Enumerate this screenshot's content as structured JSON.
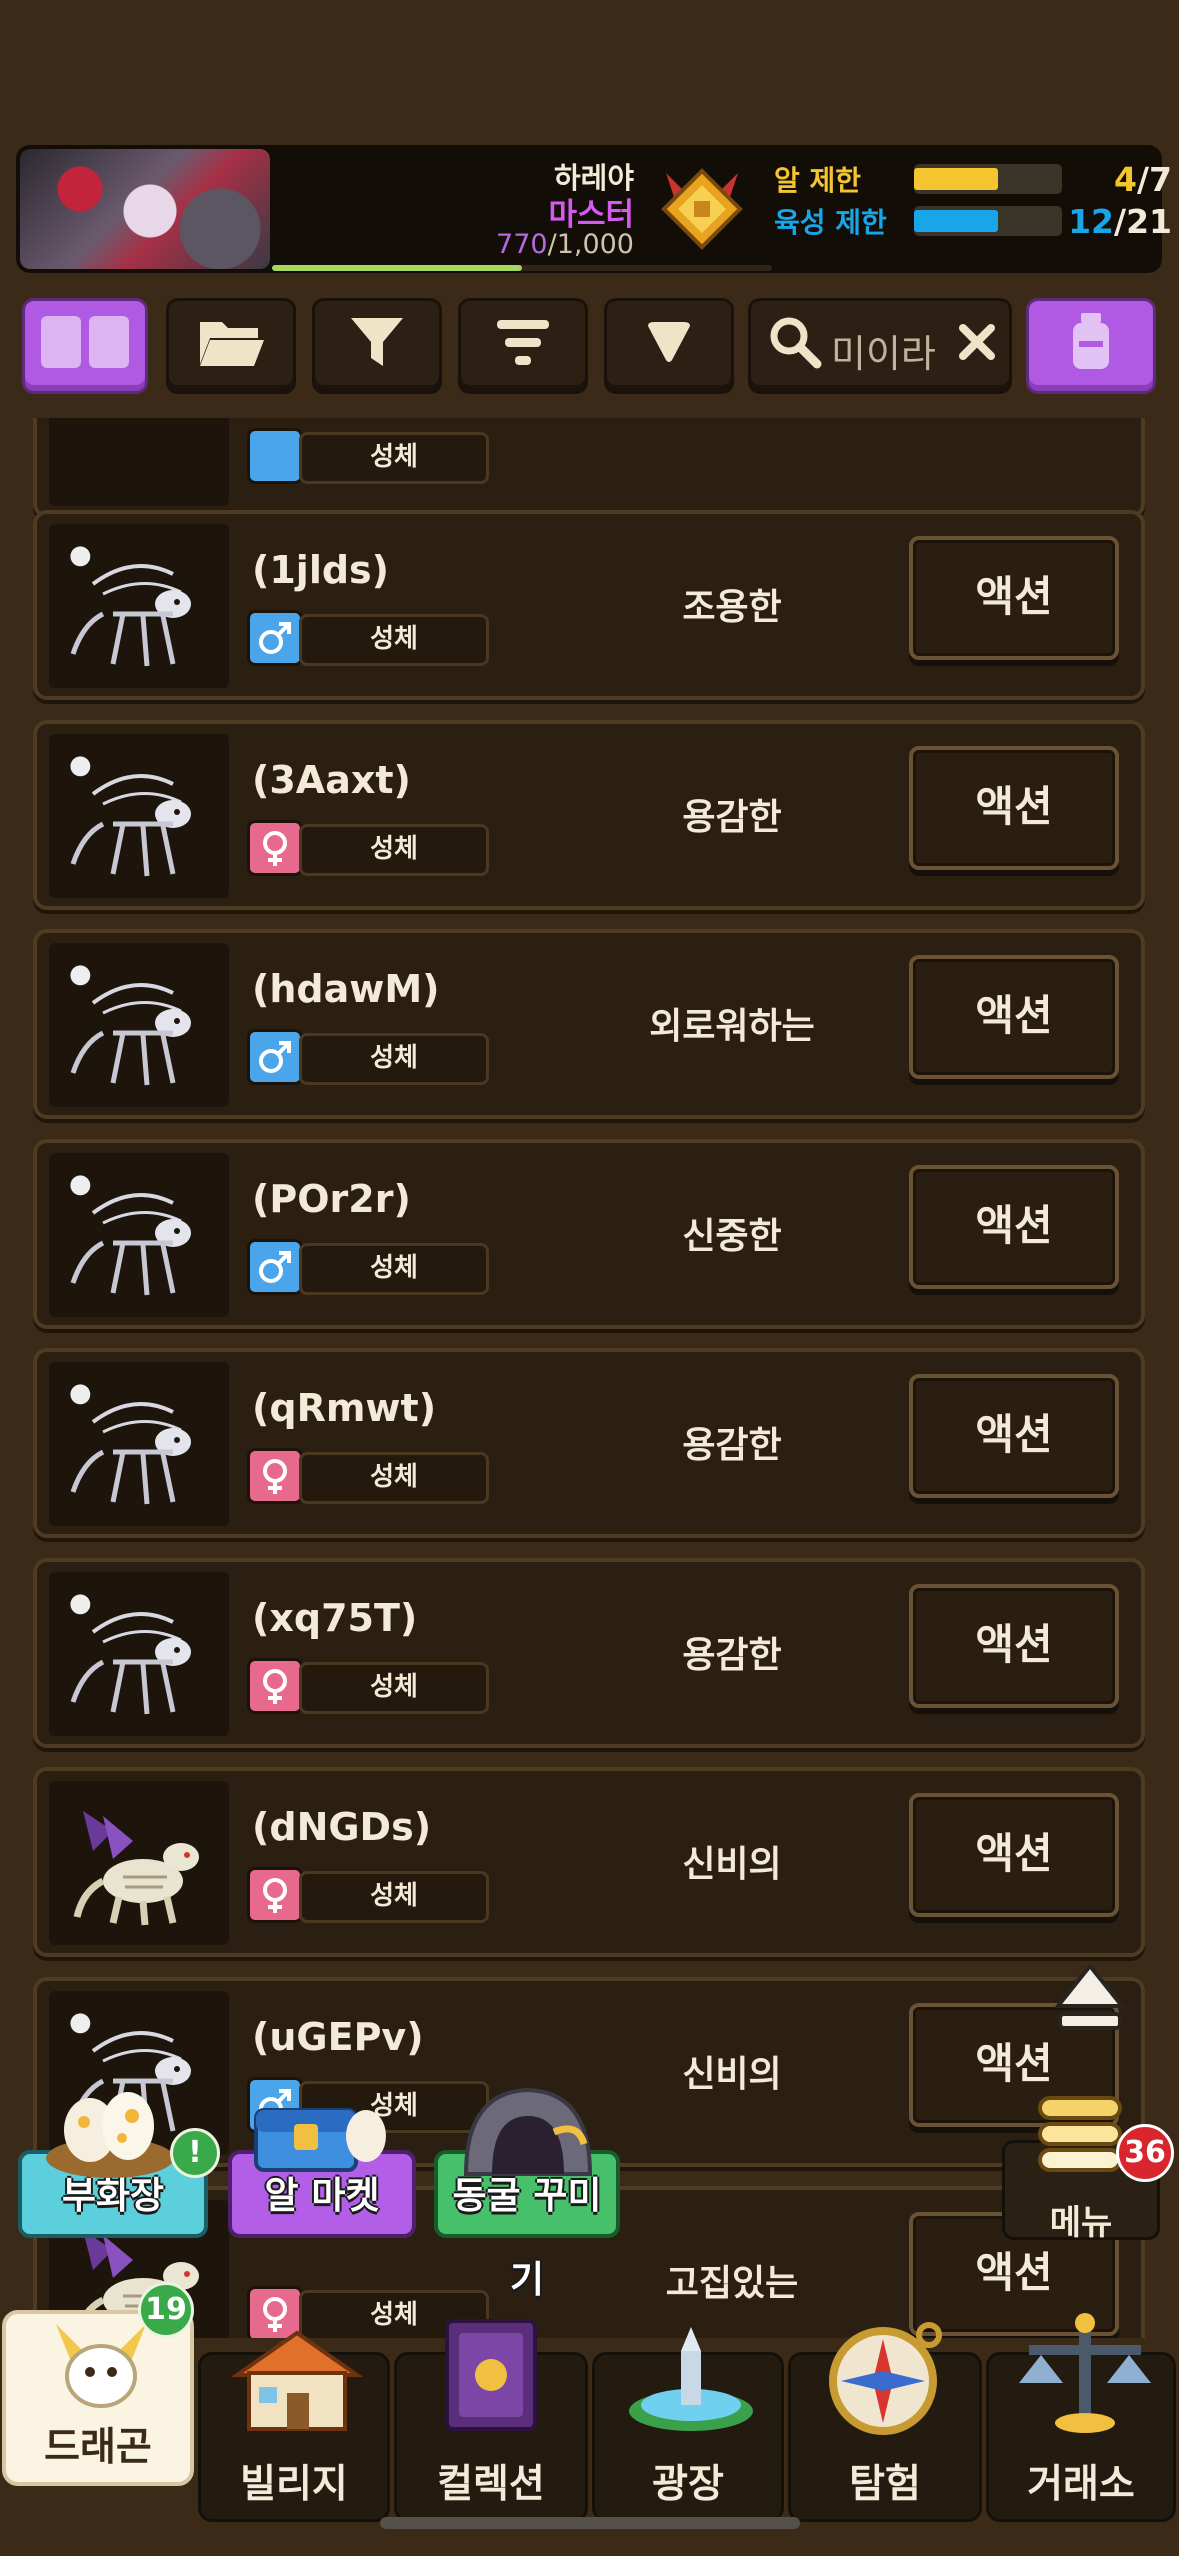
{
  "header": {
    "player_name": "하레야",
    "player_rank": "마스터",
    "exp_current": "770",
    "exp_max": "/1,000",
    "exp_fraction": 0.77,
    "egg_limit_label": "알 제한",
    "egg_limit_current": "4",
    "egg_limit_max": "/7",
    "egg_limit_fraction": 0.57,
    "breed_limit_label": "육성 제한",
    "breed_limit_current": "12",
    "breed_limit_max": "/21",
    "breed_limit_fraction": 0.57,
    "colors": {
      "egg": "#f4c52f",
      "breed": "#19a6e8",
      "rank": "#d65af0"
    }
  },
  "toolbar": {
    "grid_icon": "grid-view-icon",
    "folder_icon": "folder-icon",
    "filter_icon": "filter-icon",
    "sort_icon": "sort-icon",
    "heart_icon": "favorite-icon",
    "search_value": "미이라",
    "clear_icon": "close-icon",
    "potion_icon": "potion-icon"
  },
  "list": {
    "partial_top": {
      "stage": "성체"
    },
    "items": [
      {
        "name": "(1jlds)",
        "gender": "male",
        "stage": "성체",
        "trait": "조용한",
        "action": "액션",
        "dead": true
      },
      {
        "name": "(3Aaxt)",
        "gender": "female",
        "stage": "성체",
        "trait": "용감한",
        "action": "액션",
        "dead": true
      },
      {
        "name": "(hdawM)",
        "gender": "male",
        "stage": "성체",
        "trait": "외로워하는",
        "action": "액션",
        "dead": true
      },
      {
        "name": "(POr2r)",
        "gender": "male",
        "stage": "성체",
        "trait": "신중한",
        "action": "액션",
        "dead": true
      },
      {
        "name": "(qRmwt)",
        "gender": "female",
        "stage": "성체",
        "trait": "용감한",
        "action": "액션",
        "dead": true
      },
      {
        "name": "(xq75T)",
        "gender": "female",
        "stage": "성체",
        "trait": "용감한",
        "action": "액션",
        "dead": true
      },
      {
        "name": "(dNGDs)",
        "gender": "female",
        "stage": "성체",
        "trait": "신비의",
        "action": "액션",
        "dead": false
      },
      {
        "name": "(uGEPv)",
        "gender": "male",
        "stage": "성체",
        "trait": "신비의",
        "action": "액션",
        "dead": true
      },
      {
        "name": "",
        "gender": "female",
        "stage": "성체",
        "trait": "고집있는",
        "action": "액션",
        "dead": false
      }
    ]
  },
  "shortcuts": {
    "hatchery": "부화장",
    "hatchery_alert": "!",
    "egg_market": "알 마켓",
    "cave_decor": "동굴 꾸미기"
  },
  "menu": {
    "label": "메뉴",
    "badge": "36"
  },
  "nav": {
    "dragon": "드래곤",
    "dragon_badge": "19",
    "village": "빌리지",
    "collection": "컬렉션",
    "plaza": "광장",
    "explore": "탐험",
    "exchange": "거래소"
  }
}
